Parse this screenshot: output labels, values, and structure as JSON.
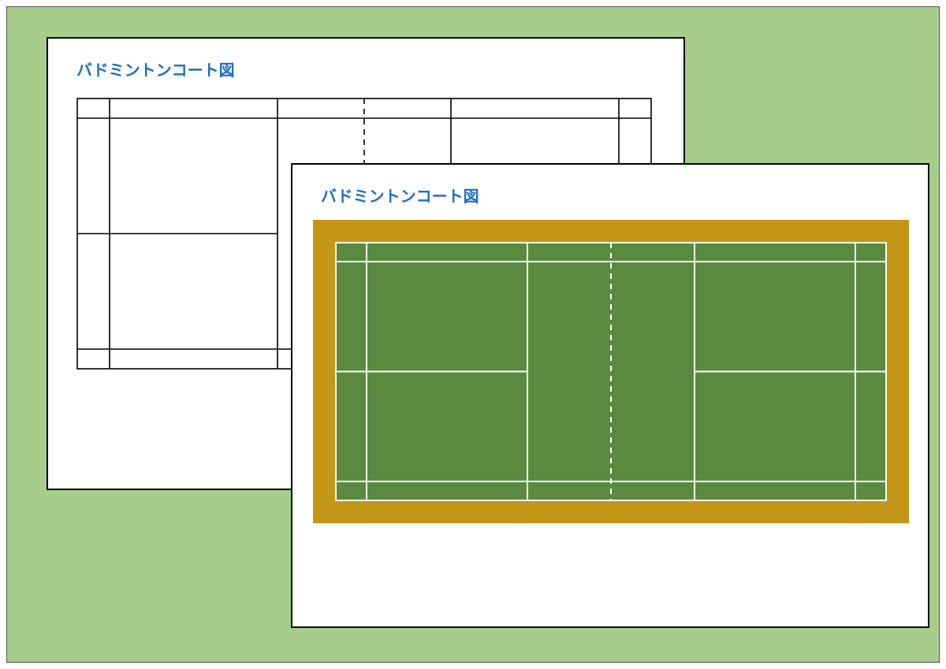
{
  "sheets": {
    "back": {
      "title": "バドミントンコート図"
    },
    "front": {
      "title": "バドミントンコート図"
    }
  },
  "colors": {
    "page_bg": "#a6cd89",
    "title_color": "#1e6fc1",
    "court_outer": "#c49616",
    "court_inner": "#5a8a3f",
    "line_light": "#ffffff",
    "line_dark": "#000000"
  },
  "court_layout_note": "Standard badminton court: outer boundary, doubles side lines, singles side lines, back boundary, doubles long service line, short service line, center line, net (dashed)."
}
